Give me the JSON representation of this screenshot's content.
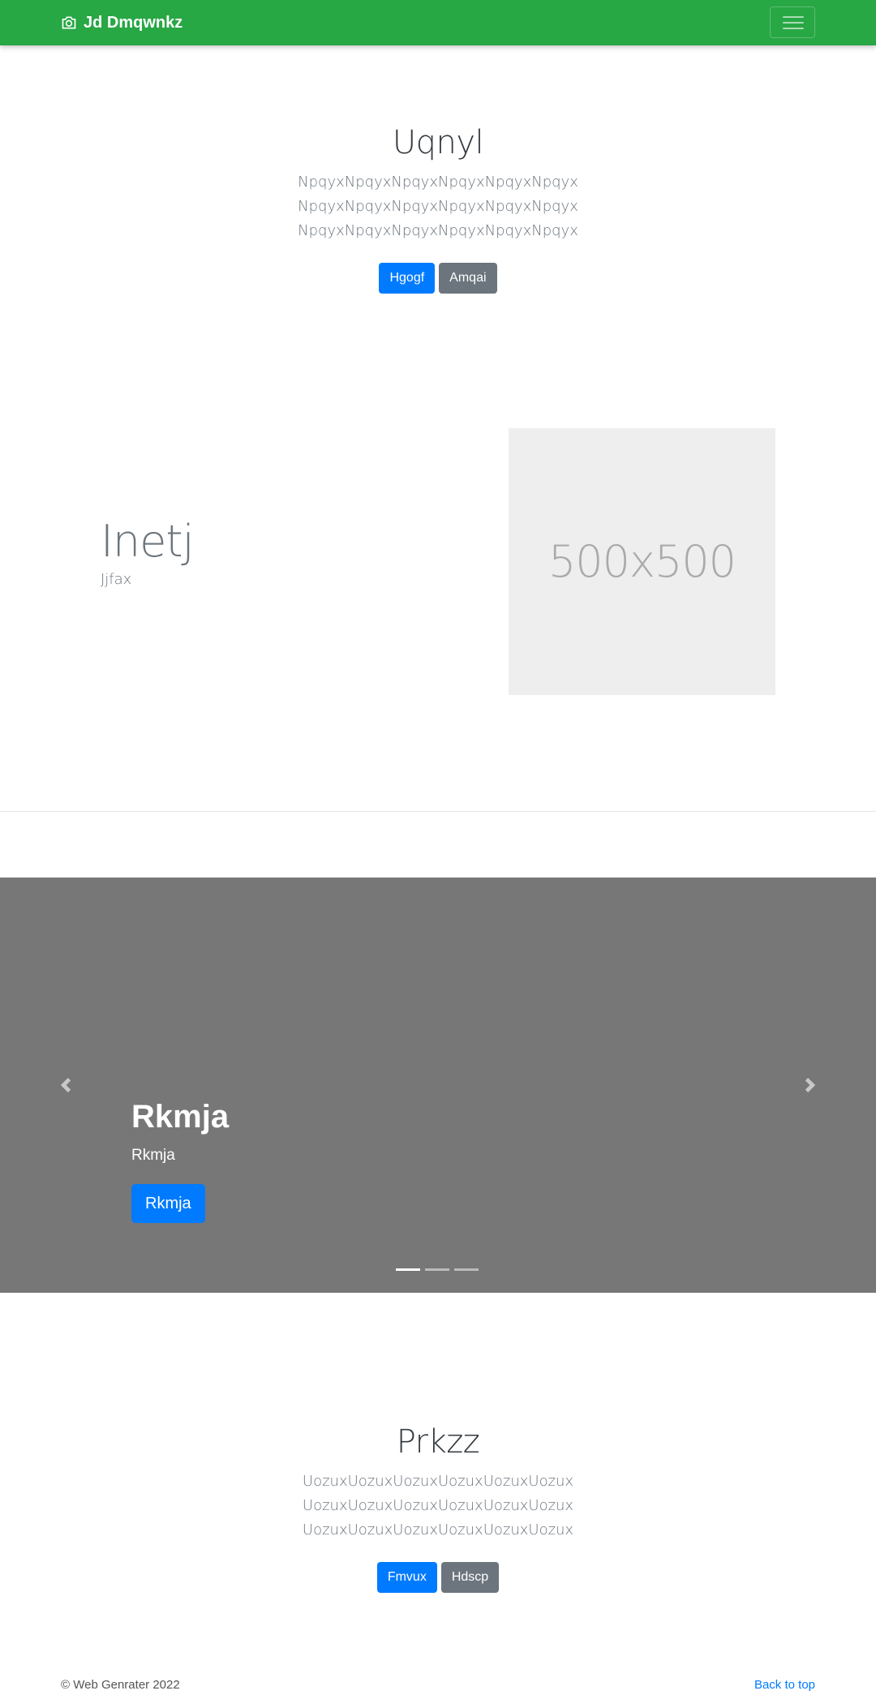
{
  "navbar": {
    "brand": "Jd Dmqwnkz",
    "brand_icon": "camera-icon",
    "toggler_icon": "hamburger-icon",
    "background": "#28a745"
  },
  "hero": {
    "title": "Uqnyl",
    "lead_lines": [
      "NpqyxNpqyxNpqyxNpqyxNpqyxNpqyx",
      "NpqyxNpqyxNpqyxNpqyxNpqyxNpqyx",
      "NpqyxNpqyxNpqyxNpqyxNpqyxNpqyx"
    ],
    "primary_button": "Hgogf",
    "secondary_button": "Amqai"
  },
  "featurette": {
    "heading": "Inetj",
    "subheading": "Jjfax",
    "image_label": "500x500"
  },
  "carousel": {
    "caption_title": "Rkmja",
    "caption_text": "Rkmja",
    "caption_button": "Rkmja",
    "prev_icon": "chevron-left-icon",
    "next_icon": "chevron-right-icon",
    "slide_count": 3,
    "active_slide": 1
  },
  "second_hero": {
    "title": "Prkzz",
    "lead_lines": [
      "UozuxUozuxUozuxUozuxUozuxUozux",
      "UozuxUozuxUozuxUozuxUozuxUozux",
      "UozuxUozuxUozuxUozuxUozuxUozux"
    ],
    "primary_button": "Fmvux",
    "secondary_button": "Hdscp"
  },
  "footer": {
    "copyright": "© Web Genrater 2022",
    "back_to_top": "Back to top"
  },
  "colors": {
    "primary": "#007bff",
    "secondary": "#6c757d",
    "carousel_bg": "#777777",
    "placeholder_bg": "#eeeeee"
  }
}
